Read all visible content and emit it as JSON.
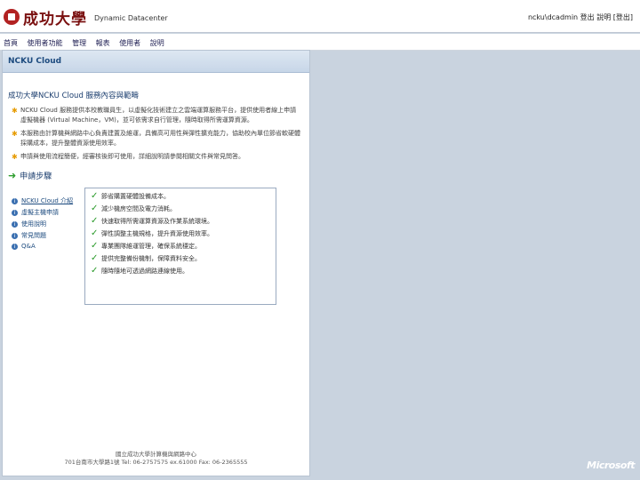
{
  "header": {
    "logo_text": "成功大學",
    "subtitle": "Dynamic Datacenter",
    "user_info": "ncku\\dcadmin 登出 說明 [登出]"
  },
  "nav": [
    "首頁",
    "使用者功能",
    "管理",
    "報表",
    "使用者",
    "說明"
  ],
  "panel": {
    "header": "NCKU Cloud",
    "section_title": "成功大學NCKU Cloud 服務內容與範疇",
    "bullets": [
      "NCKU Cloud 服務提供本校教職員生，以虛擬化技術建立之雲端運算服務平台，提供使用者線上申請虛擬機器 (Virtual Machine，VM)，並可依需求自行管理，隨時取得所需運算資源。",
      "本服務由計算機與網路中心負責建置及維運，具備高可用性與彈性擴充能力，協助校內單位節省軟硬體採購成本，提升整體資源使用效率。",
      "申請與使用流程簡便，經審核後即可使用，詳細說明請參閱相關文件與常見問答。"
    ],
    "reasons_title": "申請步驟",
    "links": [
      "NCKU Cloud 介紹",
      "虛擬主機申請",
      "使用說明",
      "常見問題",
      "Q&A"
    ],
    "checks": [
      "節省購置硬體設備成本。",
      "減少機房空間及電力消耗。",
      "快速取得所需運算資源及作業系統環境。",
      "彈性調整主機規格，提升資源使用效率。",
      "專業團隊維運管理，確保系統穩定。",
      "提供完整備份機制，保障資料安全。",
      "隨時隨地可透過網路連線使用。"
    ],
    "footer_line1": "國立成功大學計算機與網路中心",
    "footer_line2": "701台南市大學路1號 Tel: 06-2757575 ex.61000 Fax: 06-2365555"
  },
  "brand": "Microsoft"
}
